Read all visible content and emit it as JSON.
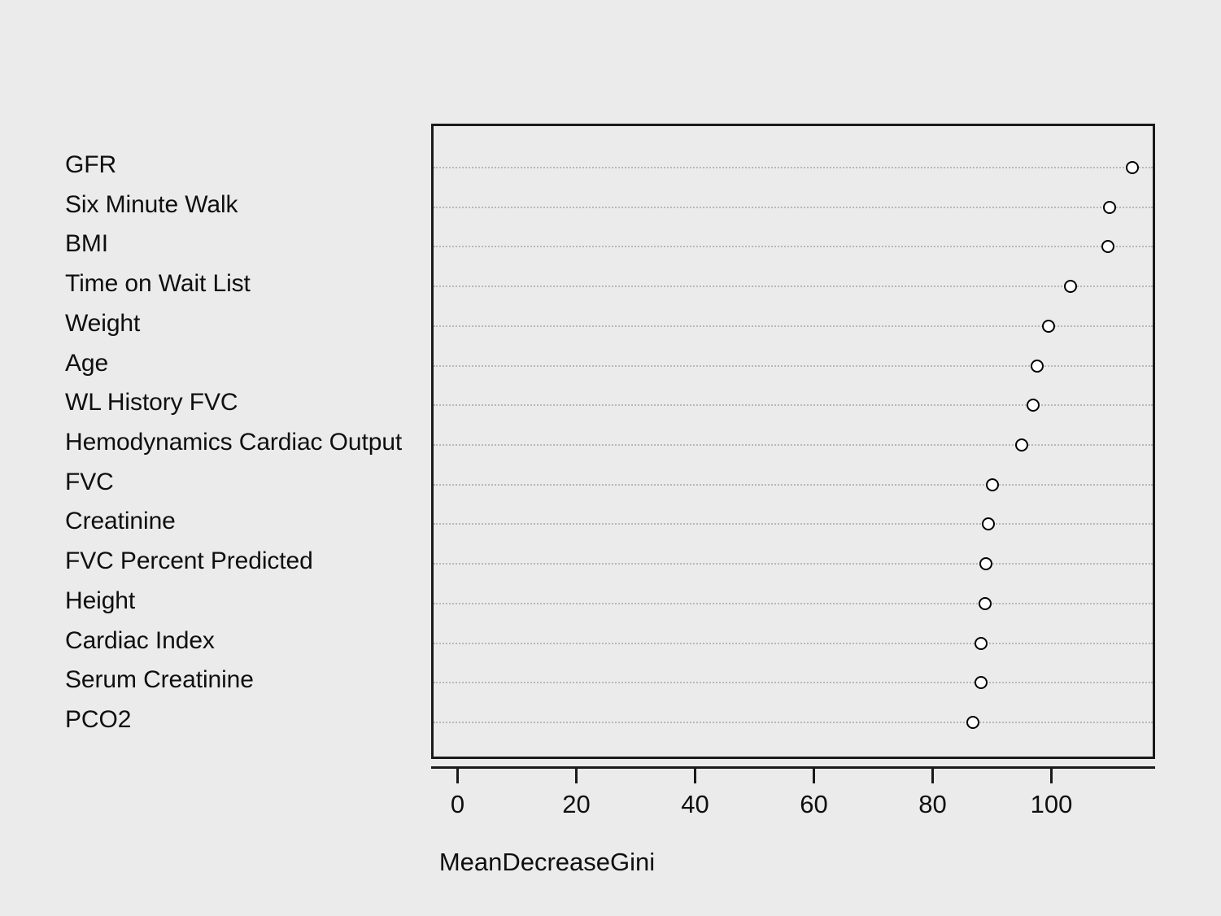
{
  "figure": {
    "background_color": "#ebebeb",
    "panel_border_color": "#1a1a1a",
    "gridline_color": "#b8b8b8",
    "point_stroke_color": "#000000",
    "point_fill_color": "#ffffff"
  },
  "axis": {
    "x_title": "MeanDecreaseGini",
    "x_ticks": [
      "0",
      "20",
      "40",
      "60",
      "80",
      "100"
    ]
  },
  "chart_data": {
    "type": "scatter",
    "subtype": "dotchart",
    "title": "",
    "subtitle": "",
    "xlabel": "MeanDecreaseGini",
    "ylabel": "",
    "xlim": [
      -2,
      119
    ],
    "xticks": [
      0,
      20,
      40,
      60,
      80,
      100
    ],
    "grid": true,
    "grid_orientation": "horizontal-dotted",
    "legend": "none",
    "orientation": "horizontal",
    "sorted": "descending",
    "categories": [
      "GFR",
      "Six Minute Walk",
      "BMI",
      "Time on Wait List",
      "Weight",
      "Age",
      "WL History FVC",
      "Hemodynamics Cardiac Output",
      "FVC",
      "Creatinine",
      "FVC Percent Predicted",
      "Height",
      "Cardiac Index",
      "Serum Creatinine",
      "PCO2"
    ],
    "values": [
      113.2,
      109.4,
      109.1,
      102.8,
      99.1,
      97.2,
      96.5,
      94.6,
      89.7,
      89.0,
      88.6,
      88.4,
      87.7,
      87.7,
      86.4
    ],
    "points": [
      {
        "label": "GFR",
        "value": 113.2
      },
      {
        "label": "Six Minute Walk",
        "value": 109.4
      },
      {
        "label": "BMI",
        "value": 109.1
      },
      {
        "label": "Time on Wait List",
        "value": 102.8
      },
      {
        "label": "Weight",
        "value": 99.1
      },
      {
        "label": "Age",
        "value": 97.2
      },
      {
        "label": "WL History FVC",
        "value": 96.5
      },
      {
        "label": "Hemodynamics Cardiac Output",
        "value": 94.6
      },
      {
        "label": "FVC",
        "value": 89.7
      },
      {
        "label": "Creatinine",
        "value": 89.0
      },
      {
        "label": "FVC Percent Predicted",
        "value": 88.6
      },
      {
        "label": "Height",
        "value": 88.4
      },
      {
        "label": "Cardiac Index",
        "value": 87.7
      },
      {
        "label": "Serum Creatinine",
        "value": 87.7
      },
      {
        "label": "PCO2",
        "value": 86.4
      }
    ]
  }
}
